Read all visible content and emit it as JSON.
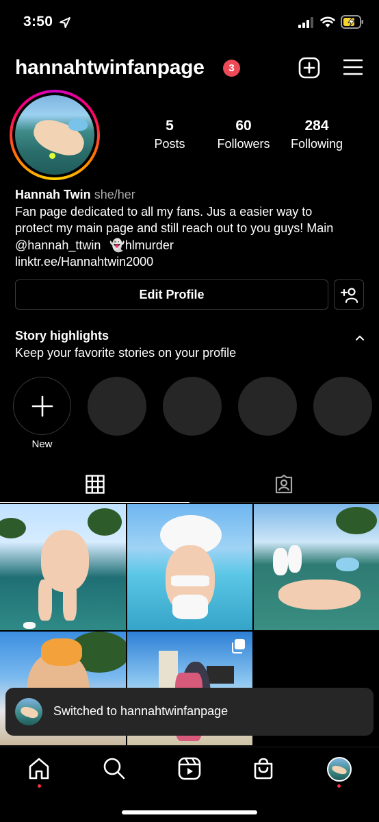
{
  "status_bar": {
    "time": "3:50",
    "icons": [
      "location-arrow-icon",
      "cellular-signal-icon",
      "wifi-icon",
      "battery-charging-icon"
    ]
  },
  "header": {
    "username": "hannahtwinfanpage",
    "notification_count": "3",
    "icons": [
      "add-post-icon",
      "menu-icon"
    ]
  },
  "stats": [
    {
      "value": "5",
      "label": "Posts"
    },
    {
      "value": "60",
      "label": "Followers"
    },
    {
      "value": "284",
      "label": "Following"
    }
  ],
  "bio": {
    "name": "Hannah Twin",
    "pronouns": "she/her",
    "line1": "Fan page dedicated to all my fans. Jus a easier way to",
    "line2": "protect my main page and still reach out to you guys! Main",
    "line3_mention": "@hannah_ttwin",
    "line3_ghost": "👻",
    "line3_snap": "hlmurder",
    "link": "linktr.ee/Hannahtwin2000"
  },
  "buttons": {
    "edit_profile": "Edit Profile"
  },
  "highlights": {
    "title": "Story highlights",
    "subtitle": "Keep your favorite stories on your profile",
    "new_label": "New"
  },
  "tabs": [
    "grid-icon",
    "tagged-icon"
  ],
  "toast": {
    "message": "Switched to hannahtwinfanpage"
  },
  "bottom_nav": [
    "home-icon",
    "search-icon",
    "reels-icon",
    "shop-icon",
    "profile-avatar"
  ],
  "colors": {
    "background": "#000000",
    "badge": "#ed4956",
    "secondary_text": "#a8a8a8",
    "placeholder_circle": "#262626"
  }
}
